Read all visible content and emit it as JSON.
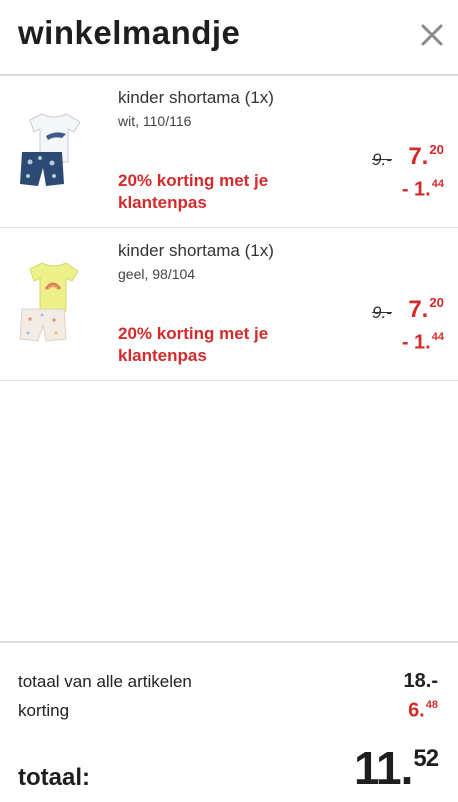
{
  "header": {
    "title": "winkelmandje",
    "close_icon": "close-icon"
  },
  "colors": {
    "promo_red": "#d22b2b",
    "divider": "#dcdcdc"
  },
  "items": [
    {
      "name": "kinder shortama (1x)",
      "variant": "wit, 110/116",
      "promo": "20% korting met je klantenpas",
      "old_price": "9.-",
      "new_price_main": "7.",
      "new_price_cents": "20",
      "discount_main": "- 1.",
      "discount_cents": "44",
      "image_icon": "pajama-white-navy-icon"
    },
    {
      "name": "kinder shortama (1x)",
      "variant": "geel, 98/104",
      "promo": "20% korting met je klantenpas",
      "old_price": "9.-",
      "new_price_main": "7.",
      "new_price_cents": "20",
      "discount_main": "- 1.",
      "discount_cents": "44",
      "image_icon": "pajama-yellow-rainbow-icon"
    }
  ],
  "summary": {
    "total_items_label": "totaal van alle artikelen",
    "total_items_value": "18.-",
    "discount_label": "korting",
    "discount_main": "6.",
    "discount_cents": "48",
    "grand_label": "totaal:",
    "grand_main": "11.",
    "grand_cents": "52"
  }
}
